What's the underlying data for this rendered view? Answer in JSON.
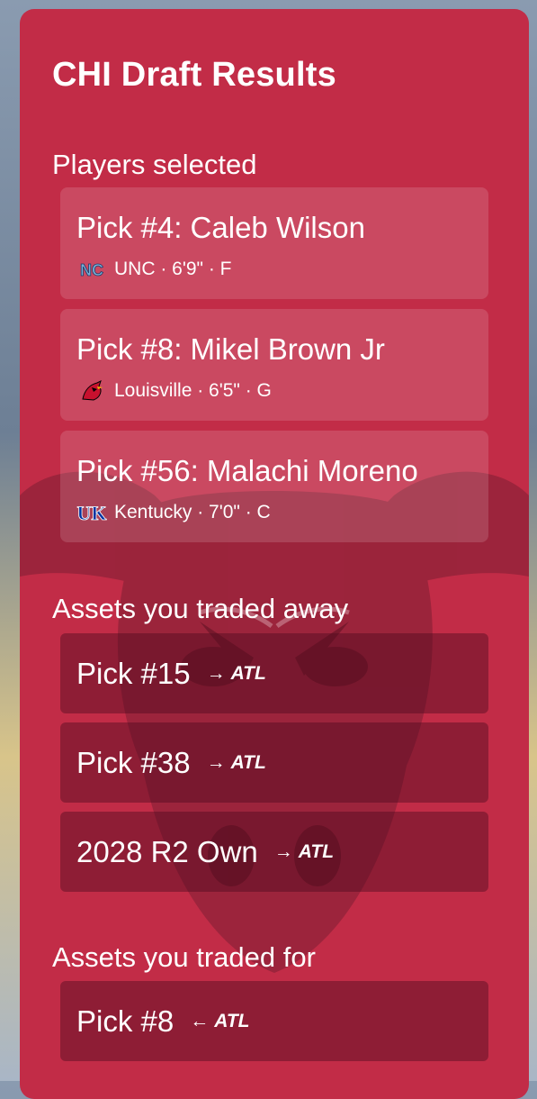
{
  "panel": {
    "title": "CHI Draft Results"
  },
  "sections": {
    "selected": "Players selected",
    "traded_away": "Assets you traded away",
    "traded_for": "Assets you traded for"
  },
  "players": [
    {
      "label": "Pick #4: Caleb Wilson",
      "meta": "UNC · 6'9\" · F",
      "school_icon": "unc-logo-icon"
    },
    {
      "label": "Pick #8: Mikel Brown Jr",
      "meta": "Louisville · 6'5\" · G",
      "school_icon": "louisville-cardinal-icon"
    },
    {
      "label": "Pick #56: Malachi Moreno",
      "meta": "Kentucky · 7'0\" · C",
      "school_icon": "kentucky-uk-icon"
    }
  ],
  "traded_away": [
    {
      "label": "Pick #15",
      "team": "ATL",
      "direction": "→"
    },
    {
      "label": "Pick #38",
      "team": "ATL",
      "direction": "→"
    },
    {
      "label": "2028 R2 Own",
      "team": "ATL",
      "direction": "→"
    }
  ],
  "traded_for": [
    {
      "label": "Pick #8",
      "team": "ATL",
      "direction": "←"
    }
  ],
  "colors": {
    "panel": "#c22c47",
    "watermark": "#8a1d33",
    "card": "#d35368",
    "asset": "#7d2036"
  }
}
